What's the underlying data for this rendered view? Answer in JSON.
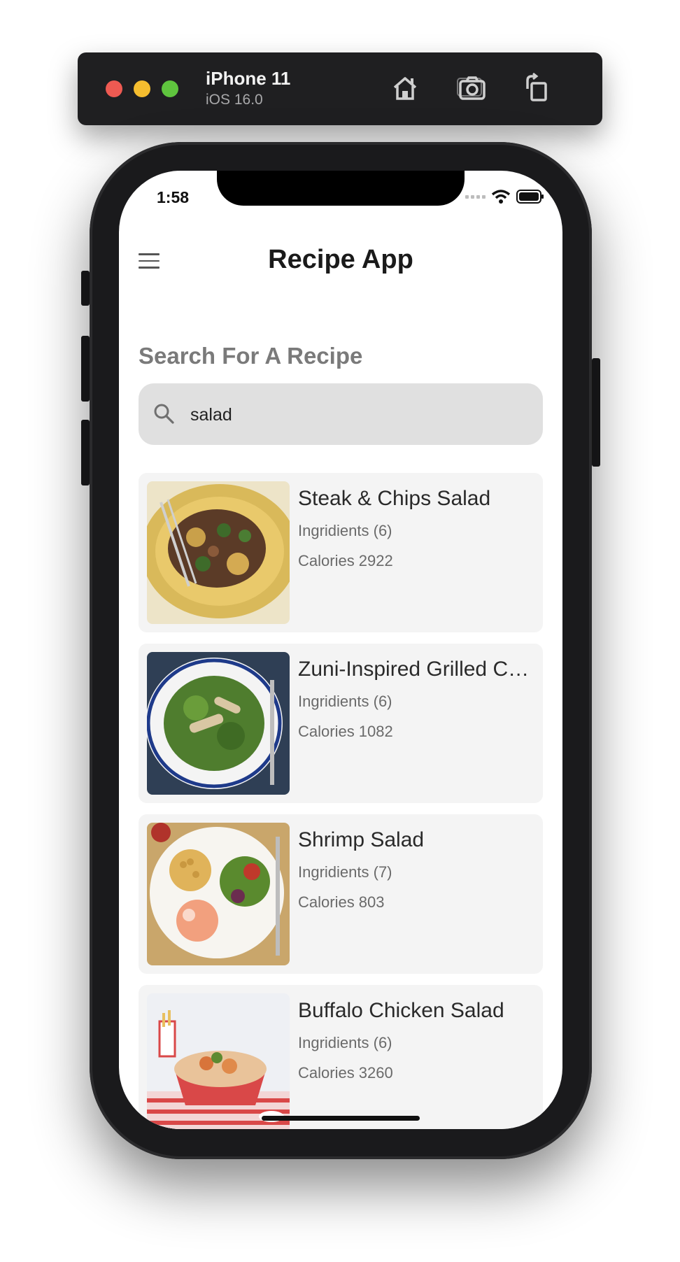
{
  "simulator": {
    "device_name": "iPhone 11",
    "os_version": "iOS 16.0",
    "icons": [
      "home-icon",
      "screenshot-icon",
      "rotate-icon"
    ]
  },
  "status_bar": {
    "time": "1:58",
    "icons": [
      "signal-icon",
      "wifi-icon",
      "battery-icon"
    ]
  },
  "header": {
    "title": "Recipe App",
    "menu_icon": "hamburger-menu-icon"
  },
  "search": {
    "heading": "Search For A Recipe",
    "value": "salad",
    "icon": "search-icon"
  },
  "recipes": [
    {
      "title": "Steak & Chips Salad",
      "ingredients": "Ingridients (6)",
      "calories": "Calories 2922"
    },
    {
      "title": "Zuni-Inspired Grilled Chicken Salad",
      "ingredients": "Ingridients (6)",
      "calories": "Calories 1082"
    },
    {
      "title": "Shrimp Salad",
      "ingredients": "Ingridients (7)",
      "calories": "Calories 803"
    },
    {
      "title": "Buffalo Chicken Salad",
      "ingredients": "Ingridients (6)",
      "calories": "Calories 3260"
    }
  ],
  "colors": {
    "search_box": "#e0e0e0",
    "card_background": "#f4f4f4",
    "heading_gray": "#7a7a7a"
  }
}
